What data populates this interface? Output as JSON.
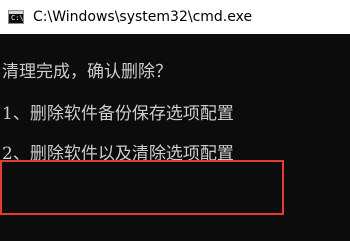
{
  "window": {
    "title": "C:\\Windows\\system32\\cmd.exe",
    "icon": "cmd-icon",
    "icon_prompt": "C:\\"
  },
  "console": {
    "lines": [
      "清理完成，确认删除？",
      "1、删除软件备份保存选项配置",
      "2、删除软件以及清除选项配置"
    ]
  },
  "highlight": {
    "color": "#e53935",
    "target_line": 3
  },
  "colors": {
    "background": "#0c0c0c",
    "text": "#cccccc",
    "titlebar": "#ffffff"
  }
}
